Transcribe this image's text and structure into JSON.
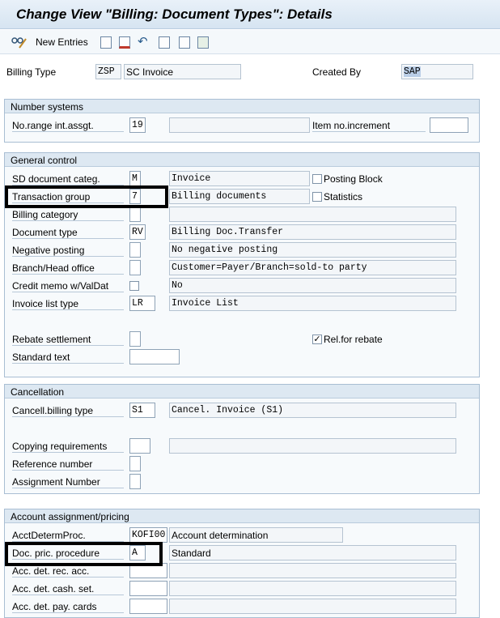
{
  "title": "Change View \"Billing: Document Types\": Details",
  "toolbar": {
    "new_entries": "New Entries"
  },
  "header": {
    "billing_type_label": "Billing Type",
    "billing_type_code": "ZSP",
    "billing_type_desc": "SC Invoice",
    "created_by_label": "Created By",
    "created_by_value": "SAP"
  },
  "number_systems": {
    "title": "Number systems",
    "nr_range_label": "No.range int.assgt.",
    "nr_range_value": "19",
    "item_inc_label": "Item no.increment",
    "item_inc_value": ""
  },
  "general": {
    "title": "General control",
    "sd_categ_label": "SD document categ.",
    "sd_categ_value": "M",
    "sd_categ_desc": "Invoice",
    "posting_block_label": "Posting Block",
    "trans_group_label": "Transaction group",
    "trans_group_value": "7",
    "trans_group_desc": "Billing documents",
    "statistics_label": "Statistics",
    "billing_cat_label": "Billing category",
    "doc_type_label": "Document type",
    "doc_type_value": "RV",
    "doc_type_desc": "Billing Doc.Transfer",
    "neg_posting_label": "Negative posting",
    "neg_posting_desc": "No negative posting",
    "branch_label": "Branch/Head office",
    "branch_desc": "Customer=Payer/Branch=sold-to party",
    "credit_memo_label": "Credit memo w/ValDat",
    "credit_memo_desc": "No",
    "invoice_list_label": "Invoice list type",
    "invoice_list_value": "LR",
    "invoice_list_desc": "Invoice List",
    "rebate_label": "Rebate settlement",
    "rel_rebate_label": "Rel.for rebate",
    "rel_rebate_checked": "✓",
    "std_text_label": "Standard text"
  },
  "cancellation": {
    "title": "Cancellation",
    "cancel_type_label": "Cancell.billing type",
    "cancel_type_value": "S1",
    "cancel_type_desc": "Cancel. Invoice (S1)",
    "copy_req_label": "Copying requirements",
    "ref_num_label": "Reference number",
    "assign_num_label": "Assignment Number"
  },
  "account": {
    "title": "Account assignment/pricing",
    "acct_proc_label": "AcctDetermProc.",
    "acct_proc_value": "KOFI00",
    "acct_proc_desc": "Account determination",
    "doc_pric_label": "Doc. pric. procedure",
    "doc_pric_value": "A",
    "doc_pric_desc": "Standard",
    "rec_acc_label": "Acc. det. rec. acc.",
    "cash_set_label": "Acc. det. cash. set.",
    "pay_cards_label": "Acc. det. pay. cards"
  }
}
